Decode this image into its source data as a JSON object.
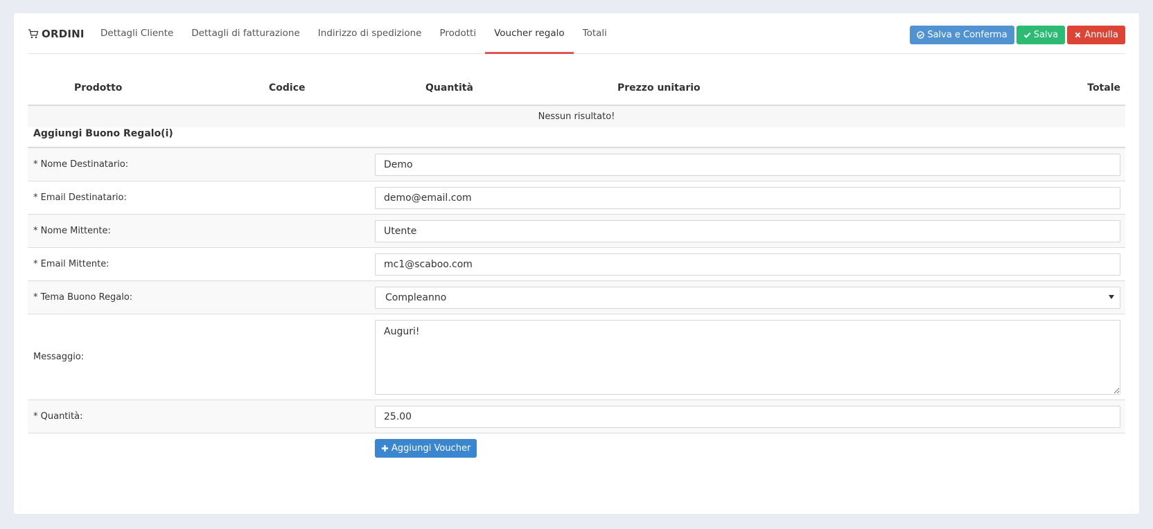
{
  "header": {
    "title": "ORDINI",
    "tabs": [
      {
        "label": "Dettagli Cliente"
      },
      {
        "label": "Dettagli di fatturazione"
      },
      {
        "label": "Indirizzo di spedizione"
      },
      {
        "label": "Prodotti"
      },
      {
        "label": "Voucher regalo"
      },
      {
        "label": "Totali"
      }
    ],
    "active_tab": "Voucher regalo",
    "buttons": {
      "save_confirm": "Salva e Conferma",
      "save": "Salva",
      "cancel": "Annulla"
    }
  },
  "products_table": {
    "columns": [
      "Prodotto",
      "Codice",
      "Quantità",
      "Prezzo unitario",
      "Totale"
    ],
    "empty_message": "Nessun risultato!"
  },
  "voucher_form": {
    "title": "Aggiungi Buono Regalo(i)",
    "fields": {
      "to_name": {
        "label": "* Nome Destinatario:",
        "value": "Demo"
      },
      "to_email": {
        "label": "* Email Destinatario:",
        "value": "demo@email.com"
      },
      "from_name": {
        "label": "* Nome Mittente:",
        "value": "Utente"
      },
      "from_email": {
        "label": "* Email Mittente:",
        "value": "mc1@scaboo.com"
      },
      "theme": {
        "label": "* Tema Buono Regalo:",
        "value": "Compleanno"
      },
      "message": {
        "label": "Messaggio:",
        "value": "Auguri!"
      },
      "amount": {
        "label": "* Quantità:",
        "value": "25.00"
      }
    },
    "add_button": "Aggiungi Voucher"
  },
  "colors": {
    "accent_tab": "#e45454",
    "blue": "#5193d1",
    "green": "#2dbb74",
    "red": "#dc4436"
  }
}
